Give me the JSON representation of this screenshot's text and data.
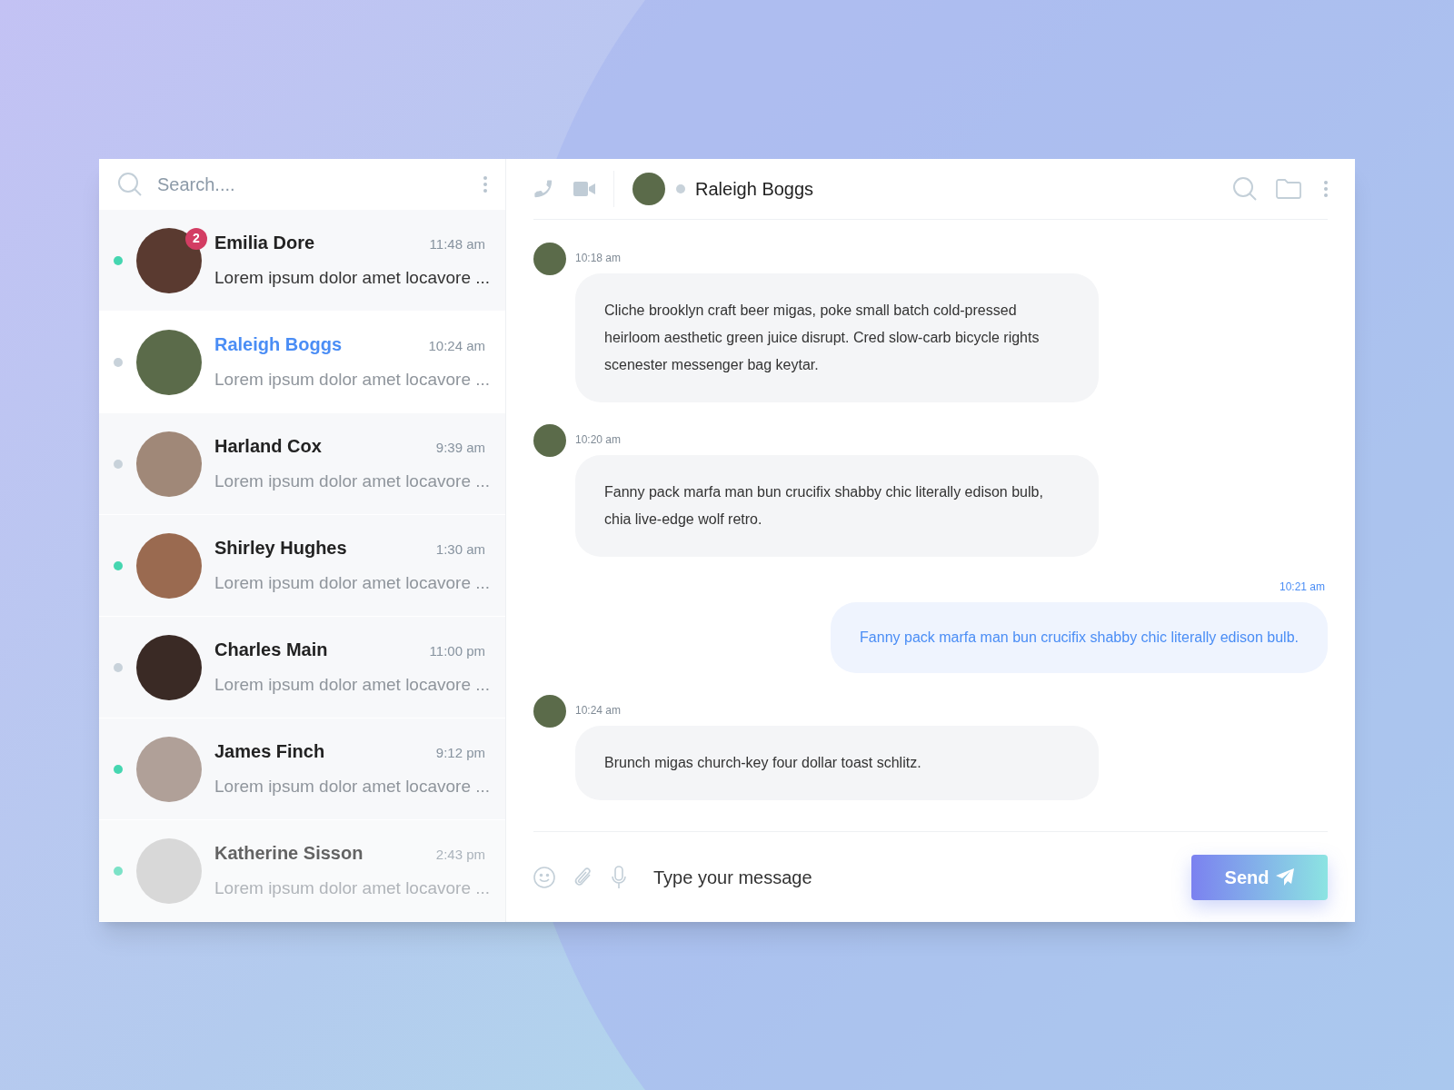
{
  "search": {
    "placeholder": "Search...."
  },
  "contacts": [
    {
      "name": "Emilia Dore",
      "time": "11:48 am",
      "preview": "Lorem ipsum dolor amet locavore ...",
      "online": true,
      "selected": false,
      "unread": true,
      "badge": "2",
      "faded": false
    },
    {
      "name": "Raleigh Boggs",
      "time": "10:24 am",
      "preview": "Lorem ipsum dolor amet locavore ...",
      "online": false,
      "selected": true,
      "unread": false,
      "faded": false
    },
    {
      "name": "Harland Cox",
      "time": "9:39 am",
      "preview": "Lorem ipsum dolor amet locavore ...",
      "online": false,
      "selected": false,
      "unread": false,
      "faded": false
    },
    {
      "name": "Shirley Hughes",
      "time": "1:30 am",
      "preview": "Lorem ipsum dolor amet locavore ...",
      "online": true,
      "selected": false,
      "unread": false,
      "faded": false
    },
    {
      "name": "Charles Main",
      "time": "11:00 pm",
      "preview": "Lorem ipsum dolor amet locavore ...",
      "online": false,
      "selected": false,
      "unread": false,
      "faded": false
    },
    {
      "name": "James Finch",
      "time": "9:12 pm",
      "preview": "Lorem ipsum dolor amet locavore ...",
      "online": true,
      "selected": false,
      "unread": false,
      "faded": false
    },
    {
      "name": "Katherine Sisson",
      "time": "2:43 pm",
      "preview": "Lorem ipsum dolor amet locavore ...",
      "online": true,
      "selected": false,
      "unread": false,
      "faded": true
    }
  ],
  "chat_header": {
    "name": "Raleigh Boggs",
    "online": false
  },
  "messages": [
    {
      "kind": "received",
      "time": "10:18 am",
      "text": "Cliche brooklyn craft beer migas, poke small batch cold-pressed heirloom aesthetic green juice disrupt. Cred slow-carb bicycle rights scenester messenger bag keytar."
    },
    {
      "kind": "received",
      "time": "10:20 am",
      "text": "Fanny pack marfa man bun crucifix shabby chic literally edison bulb, chia live-edge wolf retro."
    },
    {
      "kind": "sent",
      "time": "10:21 am",
      "text": "Fanny pack marfa man bun crucifix shabby chic literally edison bulb."
    },
    {
      "kind": "received",
      "time": "10:24 am",
      "text": "Brunch migas church-key four dollar toast schlitz."
    }
  ],
  "composer": {
    "placeholder": "Type your message",
    "send": "Send"
  }
}
